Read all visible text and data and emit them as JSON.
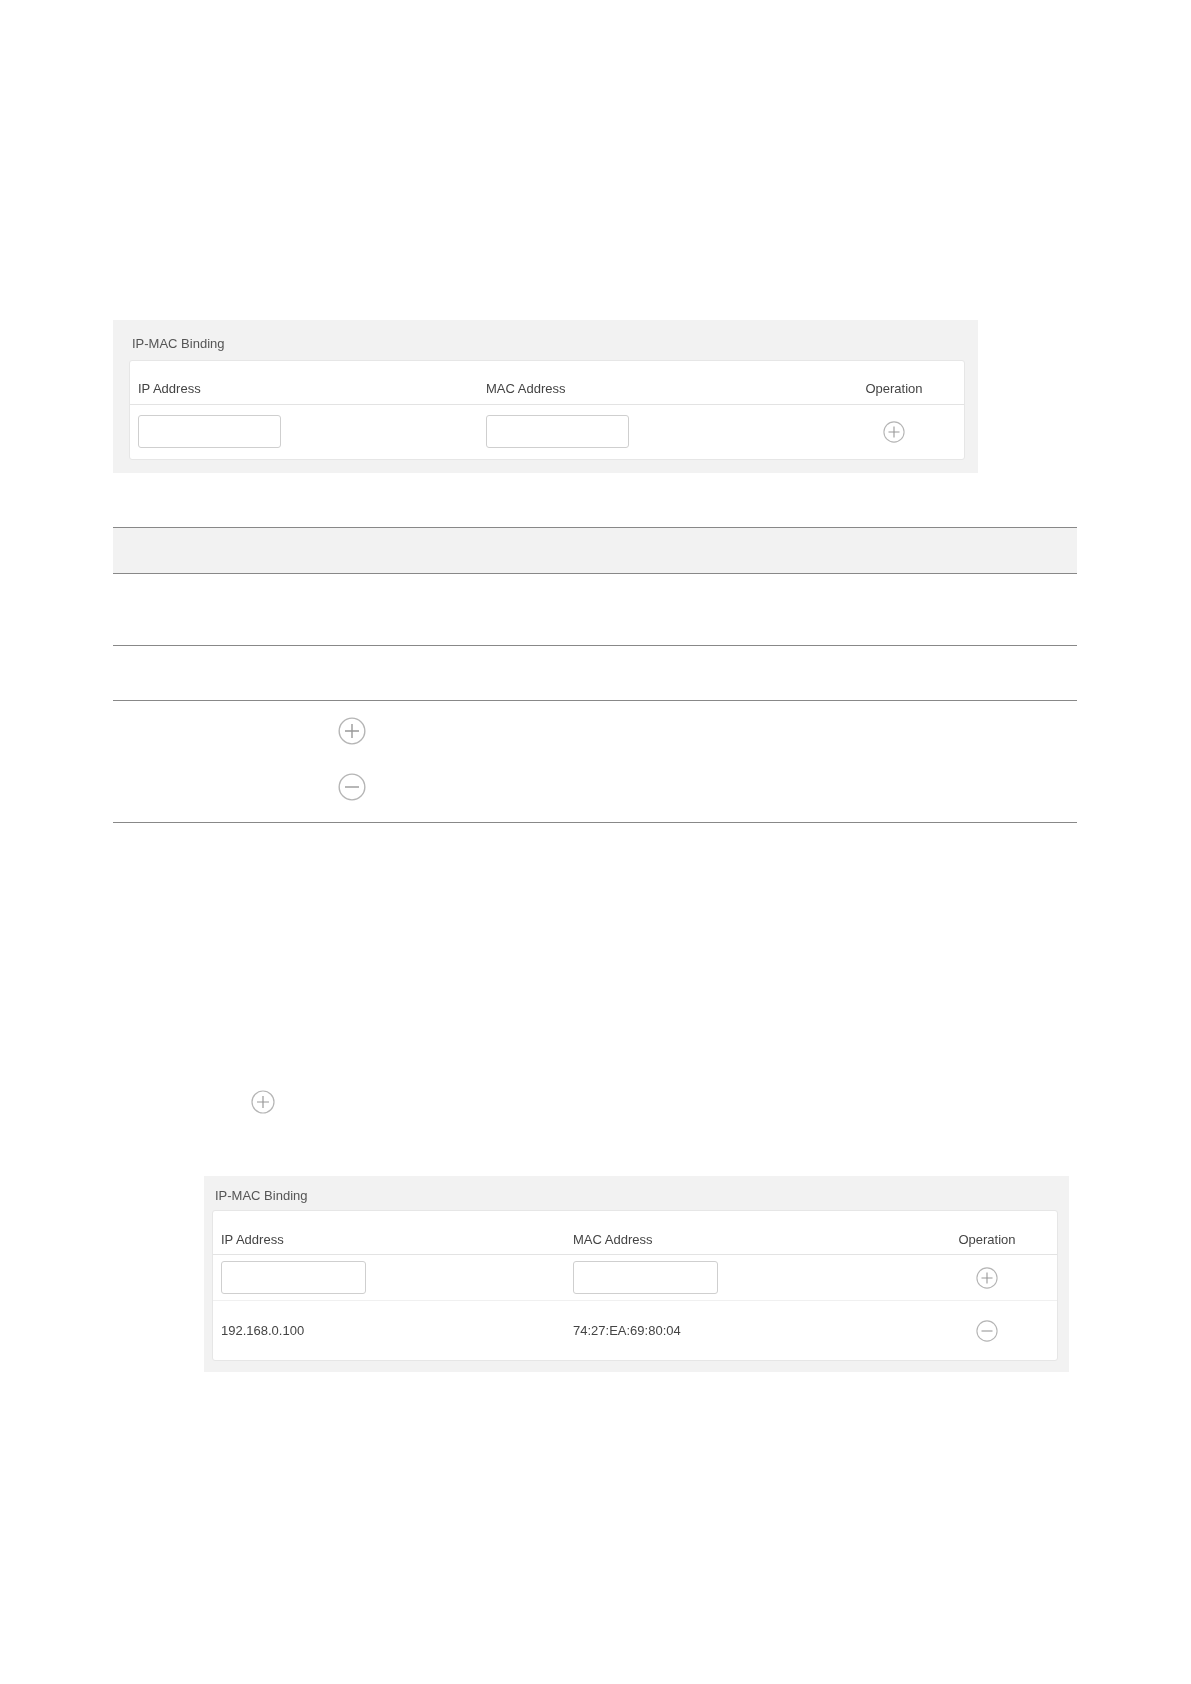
{
  "panels": [
    {
      "title": "IP-MAC Binding",
      "columns": [
        "IP Address",
        "MAC Address",
        "Operation"
      ],
      "rows": [
        {
          "kind": "input",
          "operation": {
            "kind": "add"
          }
        }
      ]
    },
    {
      "title": "IP-MAC Binding",
      "columns": [
        "IP Address",
        "MAC Address",
        "Operation"
      ],
      "rows": [
        {
          "kind": "input",
          "operation": {
            "kind": "add"
          }
        },
        {
          "kind": "entry",
          "ip": "192.168.0.100",
          "mac": "74:27:EA:69:80:04",
          "operation": {
            "kind": "remove"
          }
        }
      ]
    }
  ],
  "doc_table": {
    "rows": [
      {
        "kind": "blank"
      },
      {
        "kind": "blank"
      },
      {
        "kind": "icons",
        "icons": [
          {
            "kind": "add"
          },
          {
            "kind": "remove"
          }
        ]
      }
    ]
  },
  "inline_icon": {
    "kind": "add"
  }
}
